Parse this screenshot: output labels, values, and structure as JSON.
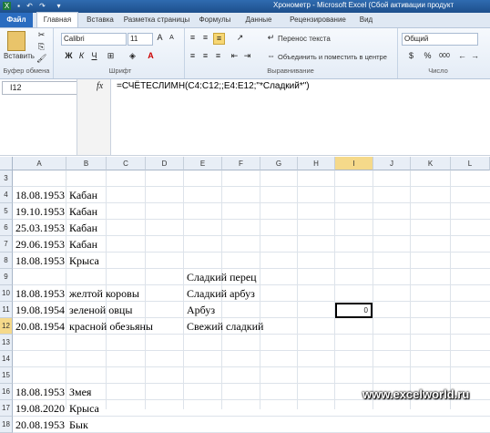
{
  "app": {
    "window_title": "Хронометр  -  Microsoft Excel (Сбой активации продукт",
    "tabs": [
      "Файл",
      "Главная",
      "Вставка",
      "Разметка страницы",
      "Формулы",
      "Данные",
      "Рецензирование",
      "Вид"
    ]
  },
  "ribbon": {
    "clipboard": {
      "paste_label": "Вставить",
      "group_label": "Буфер обмена"
    },
    "font": {
      "font_name": "Calibri",
      "font_size": "11",
      "bold": "Ж",
      "italic": "К",
      "underline": "Ч",
      "group_label": "Шрифт"
    },
    "alignment": {
      "wrap_text": "Перенос текста",
      "merge_center": "Объединить и поместить в центре",
      "group_label": "Выравнивание"
    },
    "number": {
      "format": "Общий",
      "percent": "%",
      "thousands": "000",
      "group_label": "Число"
    }
  },
  "formula_bar": {
    "name_box": "I12",
    "fx": "fx",
    "formula": "=СЧЁТЕСЛИМН(C4:C12;;E4:E12;\"*Сладкий*\")"
  },
  "grid": {
    "columns": [
      "A",
      "B",
      "C",
      "D",
      "E",
      "F",
      "G",
      "H",
      "I",
      "J",
      "K",
      "L"
    ],
    "rows": [
      "3",
      "4",
      "5",
      "6",
      "7",
      "8",
      "9",
      "10",
      "11",
      "12",
      "13",
      "14",
      "15",
      "16",
      "17",
      "18"
    ],
    "cells": {
      "A4": "18.08.1953",
      "B4": "Кабан",
      "A5": "19.10.1953",
      "B5": "Кабан",
      "A6": "25.03.1953",
      "B6": "Кабан",
      "A7": "29.06.1953",
      "B7": "Кабан",
      "A8": "18.08.1953",
      "B8": "Крыса",
      "E9": "Сладкий перец",
      "A10": "18.08.1953",
      "B10": "желтой коровы",
      "E10": "Сладкий арбуз",
      "A11": "19.08.1954",
      "B11": "зеленой овцы",
      "E11": "Арбуз",
      "A12": "20.08.1954",
      "B12": "красной обезьяны",
      "E12": "Свежий сладкий",
      "I12": "0",
      "A16": "18.08.1953",
      "B16": "Змея",
      "A17": "19.08.2020",
      "B17": "Крыса",
      "A18": "20.08.1953",
      "B18": "Бык"
    }
  },
  "watermark": "www.excelworld.ru"
}
